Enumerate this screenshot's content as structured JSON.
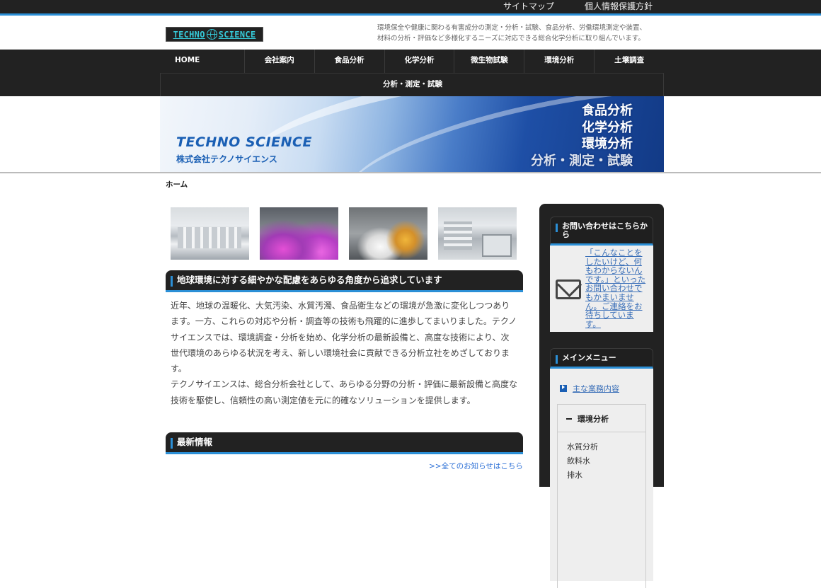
{
  "topbar": {
    "sitemap": "サイトマップ",
    "privacy": "個人情報保護方針"
  },
  "header": {
    "logo_left": "TECHNO",
    "logo_right": "SCIENCE",
    "tagline_1": "環境保全や健康に関わる有害成分の測定・分析・試験、食品分析、労働環境測定や装置、",
    "tagline_2": "材料の分析・評価など多様化するニーズに対応できる総合化学分析に取り組んでいます。"
  },
  "nav": {
    "items": [
      "HOME",
      "会社案内",
      "食品分析",
      "化学分析",
      "微生物試験",
      "環境分析",
      "土壌調査"
    ],
    "row2": "分析・測定・試験"
  },
  "banner": {
    "title": "TECHNO SCIENCE",
    "company": "株式会社テクノサイエンス",
    "categories": [
      "食品分析",
      "化学分析",
      "環境分析",
      "分析・測定・試験"
    ]
  },
  "breadcrumb": "ホーム",
  "main": {
    "heading": "地球環境に対する細やかな配慮をあらゆる角度から追求しています",
    "paragraph_1": "近年、地球の温暖化、大気汚染、水質汚濁、食品衛生などの環境が急激に変化しつつあります。一方、これらの対応や分析・調査等の技術も飛躍的に進歩してまいりました。テクノサイエンスでは、環境調査・分析を始め、化学分析の最新設備と、高度な技術により、次世代環境のあらゆる状況を考え、新しい環境社会に貢献できる分析立社をめざしております。",
    "paragraph_2": "テクノサイエンスは、総合分析会社として、あらゆる分野の分析・評価に最新設備と高度な技術を駆使し、信頼性の高い測定値を元に的確なソリューションを提供します。",
    "news_heading": "最新情報",
    "all_news_link": ">>全てのお知らせはこちら"
  },
  "sidebar": {
    "contact_title": "お問い合わせはこちらから",
    "contact_text": "「こんなことをしたいけど、何もわからないんです。」といったお問い合わせでもかまいません。ご連絡をお待ちしています。",
    "menu_title": "メインメニュー",
    "main_link": "主な業務内容",
    "sub_title": "環境分析",
    "sub_items": [
      "水質分析",
      "飲料水",
      "排水"
    ]
  },
  "colors": {
    "accent": "#2b8fd6",
    "dark": "#222222",
    "link": "#3a6fb8"
  }
}
